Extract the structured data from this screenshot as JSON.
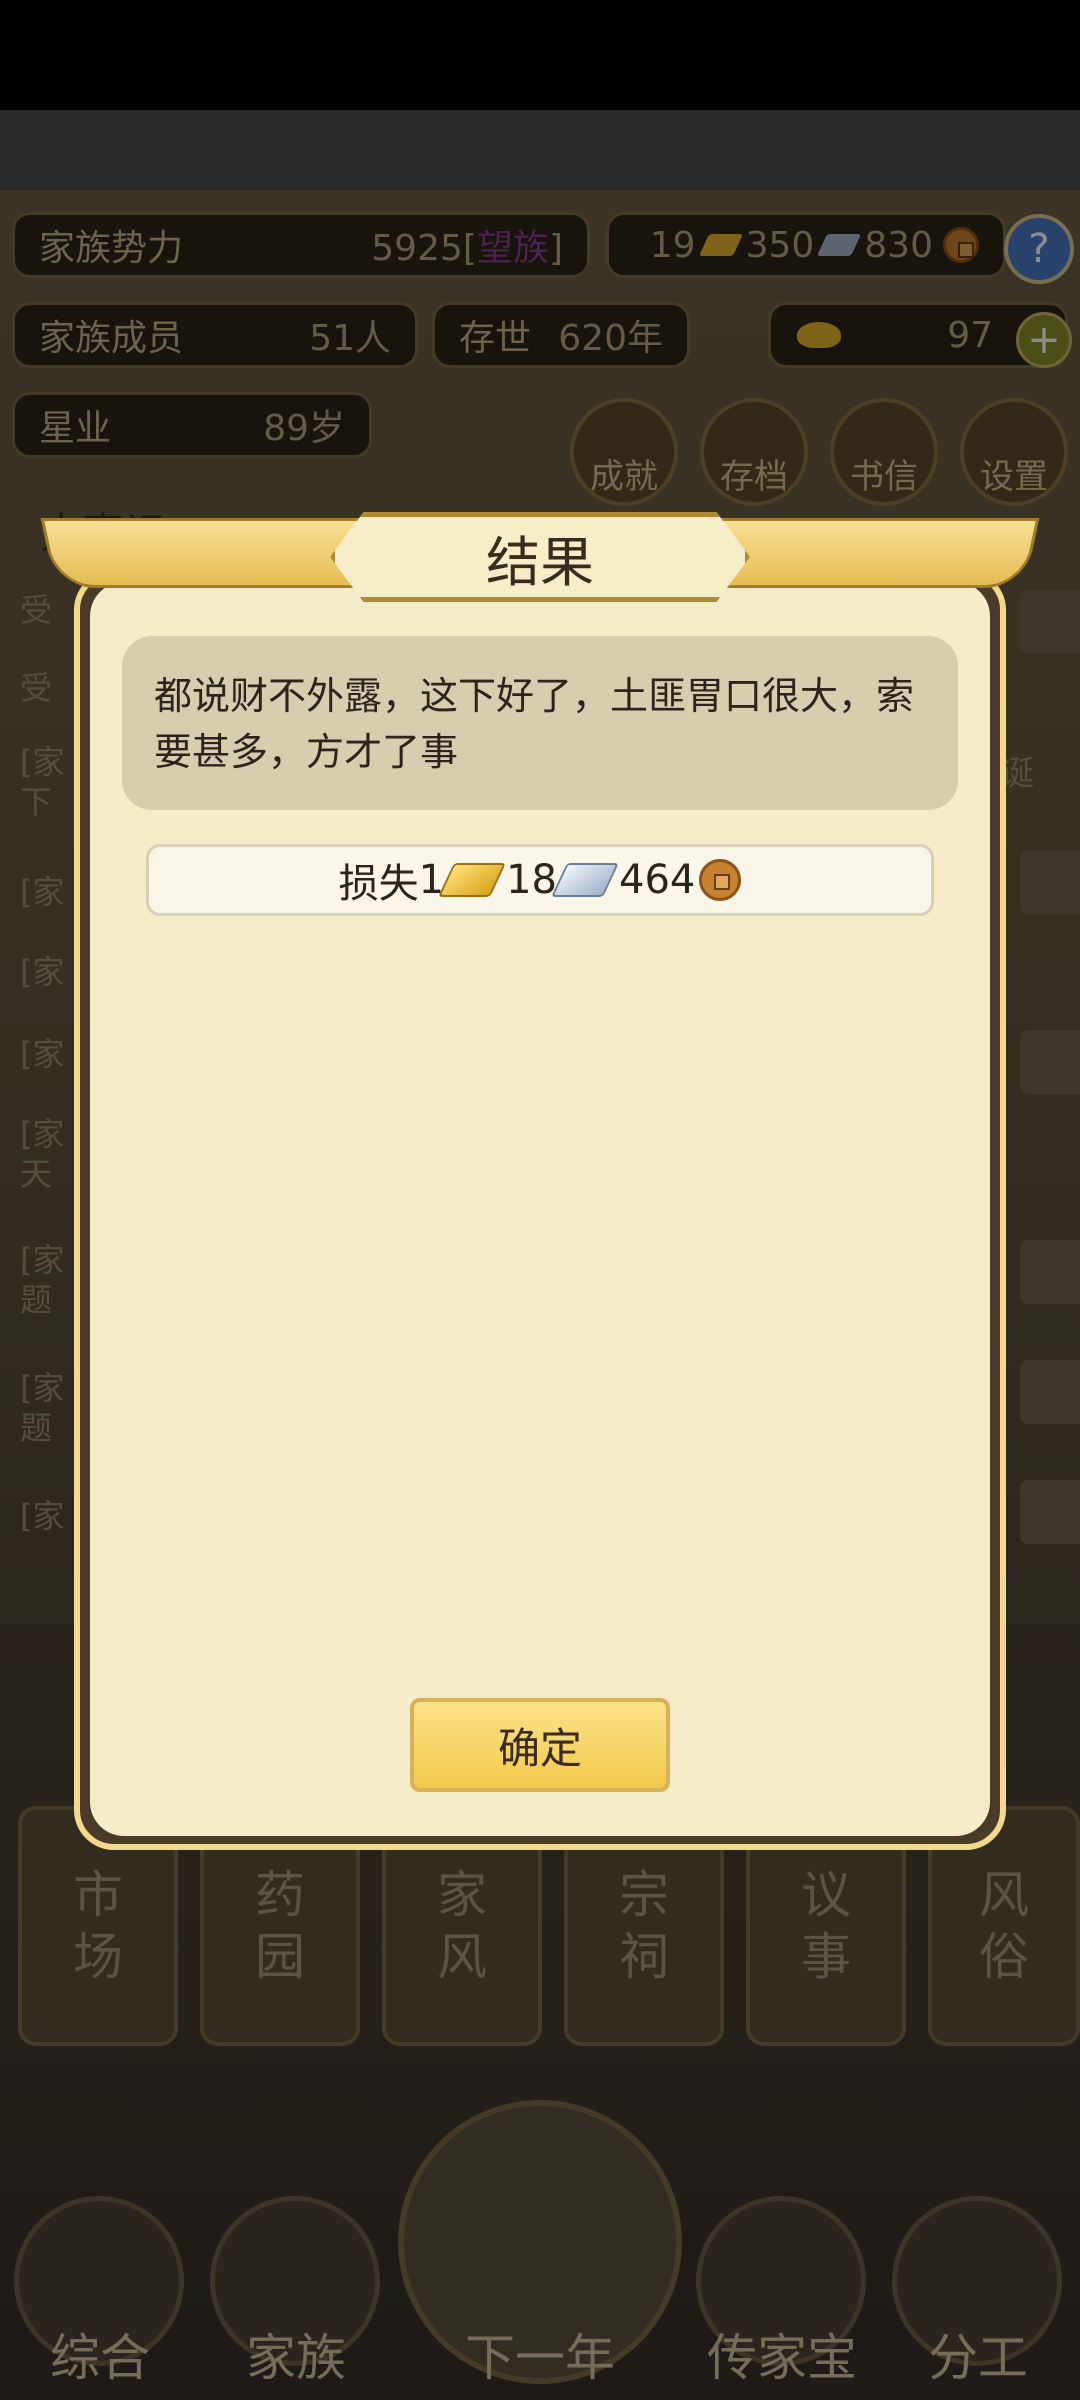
{
  "hud": {
    "power_label": "家族势力",
    "power_value": "5925",
    "power_rank": "望族",
    "gold": "19",
    "silver": "350",
    "copper": "830",
    "help": "?",
    "members_label": "家族成员",
    "members_value": "51人",
    "survival_label": "存世",
    "survival_value": "620年",
    "ingots": "97",
    "plus": "+",
    "leader_name": "星业",
    "leader_age": "89岁",
    "menu": [
      "成就",
      "存档",
      "书信",
      "设置"
    ],
    "chronicle_title": "大事记"
  },
  "log": {
    "rows": [
      "受",
      "受",
      "[家\n下",
      "[家",
      "[家",
      "[家",
      "[家\n天",
      "[家\n题",
      "[家\n题",
      "[家"
    ],
    "side_text": "诞"
  },
  "tiles": [
    "市场",
    "药园",
    "家风",
    "宗祠",
    "议事",
    "风俗"
  ],
  "bottom_nav": [
    "综合",
    "家族",
    "下一年",
    "传家宝",
    "分工"
  ],
  "dialog": {
    "title": "结果",
    "message": "都说财不外露，这下好了，土匪胃口很大，索要甚多，方才了事",
    "loss_label": "损失",
    "loss_gold": "1",
    "loss_silver": "18",
    "loss_copper": "464",
    "confirm": "确定"
  },
  "colors": {
    "dialog_bg": "#f5ecca",
    "button_gold": "#f2c94c",
    "rank_purple": "#8c3f8f"
  }
}
